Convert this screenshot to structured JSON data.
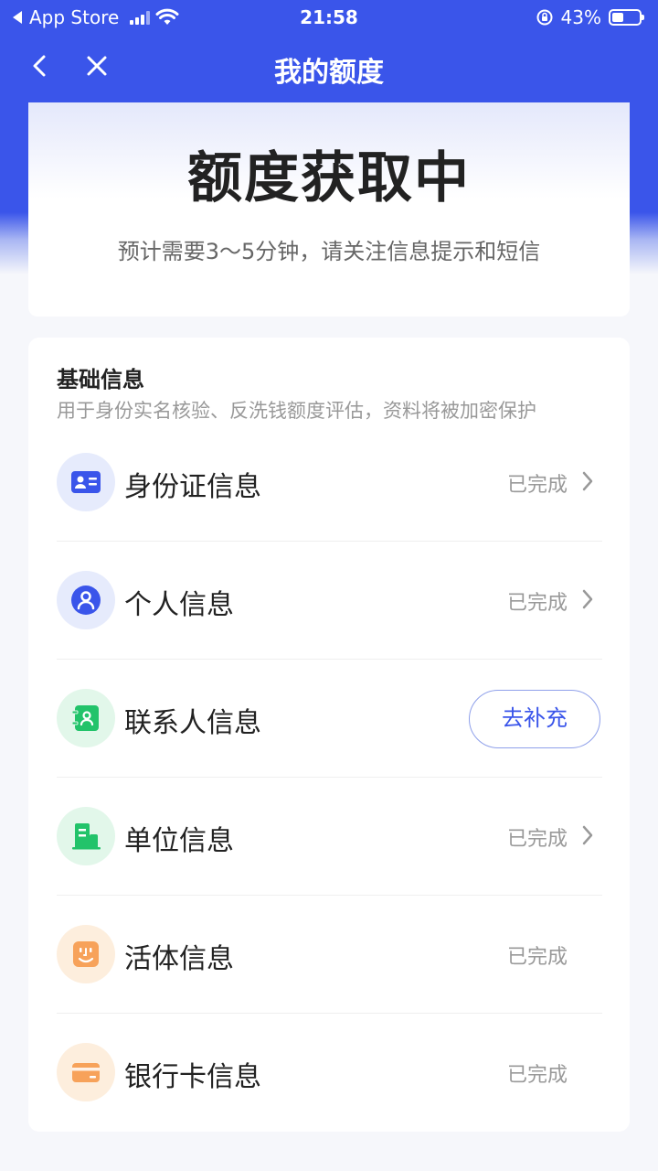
{
  "status_bar": {
    "back_app": "App Store",
    "time": "21:58",
    "battery_text": "43%",
    "battery_level": 0.43
  },
  "nav": {
    "title": "我的额度",
    "back_icon": "chevron-left-icon",
    "close_icon": "close-icon"
  },
  "status_card": {
    "heading": "额度获取中",
    "subtitle": "预计需要3～5分钟，请关注信息提示和短信"
  },
  "basic_info": {
    "title": "基础信息",
    "description": "用于身份实名核验、反洗钱额度评估，资料将被加密保护",
    "items": [
      {
        "label": "身份证信息",
        "status": "已完成",
        "icon": "id-card-icon",
        "chevron": true
      },
      {
        "label": "个人信息",
        "status": "已完成",
        "icon": "person-icon",
        "chevron": true
      },
      {
        "label": "联系人信息",
        "action": "去补充",
        "icon": "contacts-icon"
      },
      {
        "label": "单位信息",
        "status": "已完成",
        "icon": "building-icon",
        "chevron": true
      },
      {
        "label": "活体信息",
        "status": "已完成",
        "icon": "face-icon",
        "chevron": false
      },
      {
        "label": "银行卡信息",
        "status": "已完成",
        "icon": "bank-card-icon",
        "chevron": false
      }
    ]
  },
  "colors": {
    "brand_blue": "#3a55ea",
    "contacts_green": "#22c36a",
    "face_orange": "#f7a25a"
  }
}
